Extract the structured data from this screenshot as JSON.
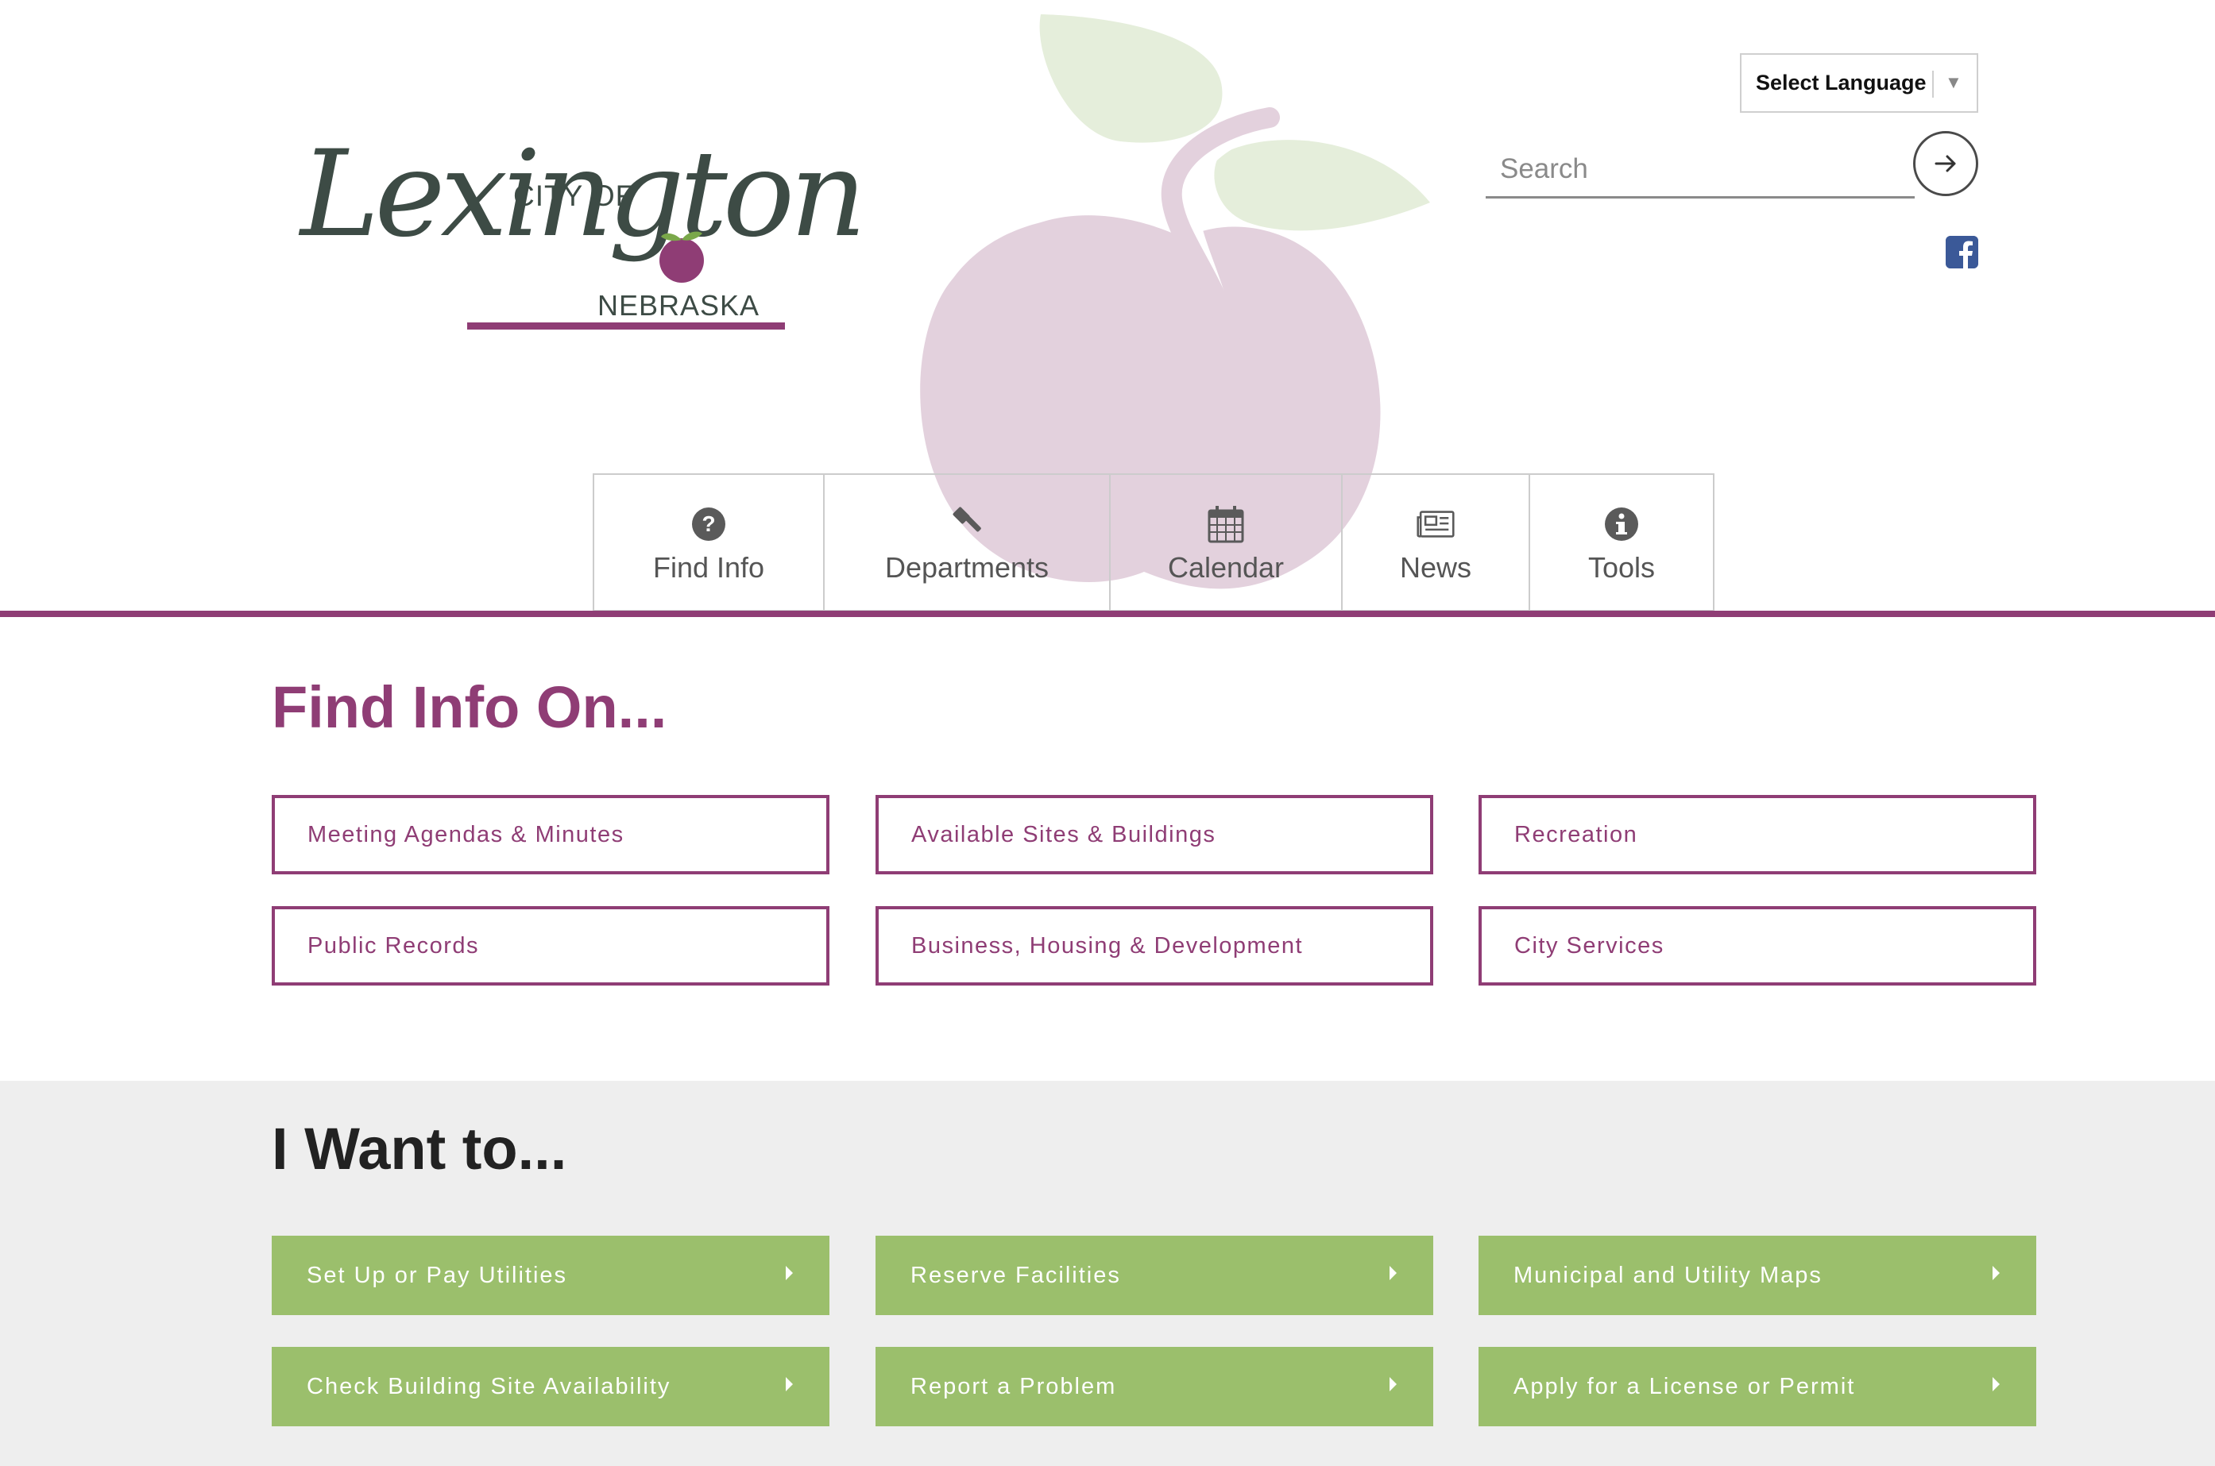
{
  "header": {
    "logo": {
      "city_of": "CITY OF",
      "script_name": "Lexington",
      "state": "NEBRASKA"
    },
    "language_select": {
      "label": "Select Language",
      "caret_icon": "triangle-down-icon"
    },
    "search": {
      "placeholder": "Search",
      "value": "",
      "button_icon": "arrow-right-icon"
    },
    "social": {
      "facebook_icon": "facebook-icon"
    }
  },
  "nav": {
    "items": [
      {
        "label": "Find Info",
        "icon": "question-circle-icon"
      },
      {
        "label": "Departments",
        "icon": "gavel-icon"
      },
      {
        "label": "Calendar",
        "icon": "calendar-icon"
      },
      {
        "label": "News",
        "icon": "newspaper-icon"
      },
      {
        "label": "Tools",
        "icon": "info-circle-icon"
      }
    ]
  },
  "find_info": {
    "title": "Find Info On...",
    "links": [
      "Meeting Agendas & Minutes",
      "Available Sites & Buildings",
      "Recreation",
      "Public Records",
      "Business, Housing & Development",
      "City Services"
    ]
  },
  "i_want_to": {
    "title": "I Want to...",
    "links": [
      "Set Up or Pay Utilities",
      "Reserve Facilities",
      "Municipal and Utility Maps",
      "Check Building Site Availability",
      "Report a Problem",
      "Apply for a License or Permit"
    ],
    "arrow_icon": "caret-right-icon"
  },
  "colors": {
    "brand_purple": "#8f3d75",
    "action_green": "#9bbf6c",
    "section_gray": "#eeeeee",
    "apple_pink": "#e3d1dd",
    "leaf_green": "#e5eedb",
    "facebook_blue": "#3b5998"
  }
}
